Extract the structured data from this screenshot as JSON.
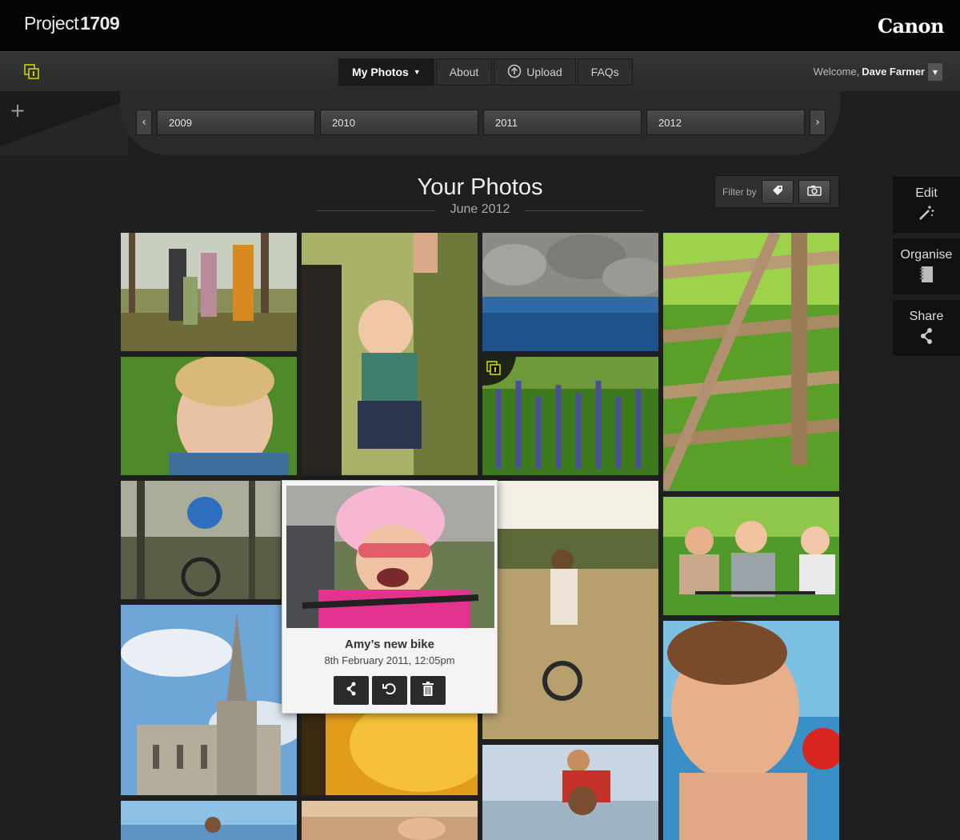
{
  "header": {
    "brand_text": "Project",
    "brand_number": "1709",
    "partner": "Canon"
  },
  "nav": {
    "items": [
      {
        "label": "My Photos",
        "active": true
      },
      {
        "label": "About"
      },
      {
        "label": "Upload",
        "icon": "upload-icon"
      },
      {
        "label": "FAQs"
      }
    ],
    "welcome_label": "Welcome,",
    "user_name": "Dave Farmer"
  },
  "years": [
    "2009",
    "2010",
    "2011",
    "2012"
  ],
  "gallery": {
    "title": "Your Photos",
    "subtitle": "June 2012",
    "filter_label": "Filter by"
  },
  "tools": [
    {
      "label": "Edit",
      "icon": "magic-wand-icon"
    },
    {
      "label": "Organise",
      "icon": "notebook-icon"
    },
    {
      "label": "Share",
      "icon": "share-icon"
    }
  ],
  "popover": {
    "title": "Amy’s new bike",
    "date": "8th February 2011, 12:05pm"
  },
  "colors": {
    "accent": "#c8d400",
    "background": "#1f1f1f"
  }
}
